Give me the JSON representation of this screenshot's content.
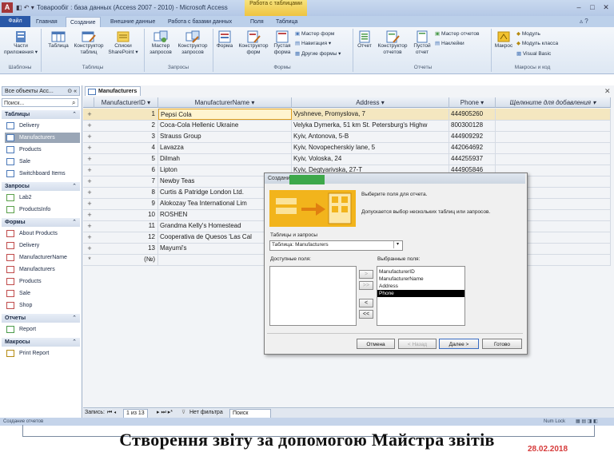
{
  "window": {
    "title": "Товарообіг : база данных (Access 2007 - 2010) - Microsoft Access",
    "contextual_tab_header": "Работа с таблицами",
    "controls": [
      "–",
      "□",
      "✕"
    ]
  },
  "ribbon": {
    "tabs": [
      "Файл",
      "Главная",
      "Создание",
      "Внешние данные",
      "Работа с базами данных",
      "Поля",
      "Таблица"
    ],
    "active_tab": "Создание",
    "groups": [
      {
        "label": "Шаблоны",
        "buttons": [
          "Части приложения ▾"
        ]
      },
      {
        "label": "Таблицы",
        "buttons": [
          "Таблица",
          "Конструктор таблиц",
          "Списки SharePoint ▾"
        ]
      },
      {
        "label": "Запросы",
        "buttons": [
          "Мастер запросов",
          "Конструктор запросов"
        ]
      },
      {
        "label": "Формы",
        "buttons": [
          "Форма",
          "Конструктор форм",
          "Пустая форма"
        ],
        "small": [
          "Мастер форм",
          "Навигация ▾",
          "Другие формы ▾"
        ]
      },
      {
        "label": "Отчеты",
        "buttons": [
          "Отчет",
          "Конструктор отчетов",
          "Пустой отчет"
        ],
        "small": [
          "Мастер отчетов",
          "Наклейки"
        ]
      },
      {
        "label": "Макросы и код",
        "buttons": [
          "Макрос"
        ],
        "small": [
          "Модуль",
          "Модуль класса",
          "Visual Basic"
        ]
      }
    ]
  },
  "nav_pane": {
    "header": "Все объекты Acc...",
    "search_placeholder": "Поиск...",
    "categories": [
      {
        "name": "Таблицы",
        "items": [
          "Delivery",
          "Manufacturers",
          "Products",
          "Sale",
          "Switchboard Items"
        ]
      },
      {
        "name": "Запросы",
        "items": [
          "Lab2",
          "ProductsInfo"
        ]
      },
      {
        "name": "Формы",
        "items": [
          "About Products",
          "Delivery",
          "ManufacturerName",
          "Manufacturers",
          "Products",
          "Sale",
          "Shop"
        ]
      },
      {
        "name": "Отчеты",
        "items": [
          "Report"
        ]
      },
      {
        "name": "Макросы",
        "items": [
          "Print Report"
        ]
      }
    ],
    "selected": "Manufacturers"
  },
  "document": {
    "tab_label": "Manufacturers",
    "columns": [
      "ManufacturerID",
      "ManufacturerName",
      "Address",
      "Phone",
      "Щелкните для добавления"
    ],
    "rows": [
      {
        "id": "1",
        "name": "Pepsi Cola",
        "address": "Vyshneve, Promyslova, 7",
        "phone": "444905260"
      },
      {
        "id": "2",
        "name": "Coca-Cola Hellenic Ukraine",
        "address": "Velyka Dymerka, 51 km St. Petersburg's Highw",
        "phone": "800300128"
      },
      {
        "id": "3",
        "name": "Strauss Group",
        "address": "Kyiv, Antonova, 5-B",
        "phone": "444909292"
      },
      {
        "id": "4",
        "name": "Lavazza",
        "address": "Kyiv, Novopecherskiy lane, 5",
        "phone": "442064692"
      },
      {
        "id": "5",
        "name": "Dilmah",
        "address": "Kyiv, Voloska, 24",
        "phone": "444255937"
      },
      {
        "id": "6",
        "name": "Lipton",
        "address": "Kyiv, Degtyarivska, 27-T",
        "phone": "444905846"
      },
      {
        "id": "7",
        "name": "Newby Teas",
        "address": "",
        "phone": ""
      },
      {
        "id": "8",
        "name": "Curtis & Patridge London Ltd.",
        "address": "",
        "phone": ""
      },
      {
        "id": "9",
        "name": "Alokozay Tea International Lim",
        "address": "",
        "phone": ""
      },
      {
        "id": "10",
        "name": "ROSHEN",
        "address": "",
        "phone": ""
      },
      {
        "id": "11",
        "name": "Grandma Kelly's Homestead",
        "address": "",
        "phone": ""
      },
      {
        "id": "12",
        "name": "Cooperativa de Quesos 'Las Cal",
        "address": "",
        "phone": ""
      },
      {
        "id": "13",
        "name": "Mayumi's",
        "address": "",
        "phone": ""
      },
      {
        "id": "(№)",
        "name": "",
        "address": "",
        "phone": ""
      }
    ],
    "record_nav": {
      "label": "Запись:",
      "position": "1 из 13",
      "filter": "Нет фильтра",
      "search": "Поиск"
    }
  },
  "status_bar": {
    "left": "Создание отчетов",
    "right": "Num Lock"
  },
  "dialog": {
    "title": "Создание отчетов",
    "instruction1": "Выберите поля для отчета.",
    "instruction2": "Допускается выбор нескольких таблиц или запросов.",
    "tables_label": "Таблицы и запросы",
    "table_select_value": "Таблица: Manufacturers",
    "available_label": "Доступные поля:",
    "selected_label": "Выбранные поля:",
    "selected_fields": [
      "ManufacturerID",
      "ManufacturerName",
      "Address",
      "Phone"
    ],
    "highlighted_field": "Phone",
    "move_buttons": [
      ">",
      ">>",
      "<",
      "<<"
    ],
    "buttons": {
      "cancel": "Отмена",
      "back": "< Назад",
      "next": "Далее >",
      "finish": "Готово"
    }
  },
  "slide": {
    "caption": "Створення звіту за допомогою Майстра звітів",
    "date": "28.02.2018"
  },
  "colors": {
    "accent_blue": "#2a58a8",
    "context_tab": "#eec340",
    "highlight": "#f2b41c",
    "date_red": "#d63a3a"
  }
}
